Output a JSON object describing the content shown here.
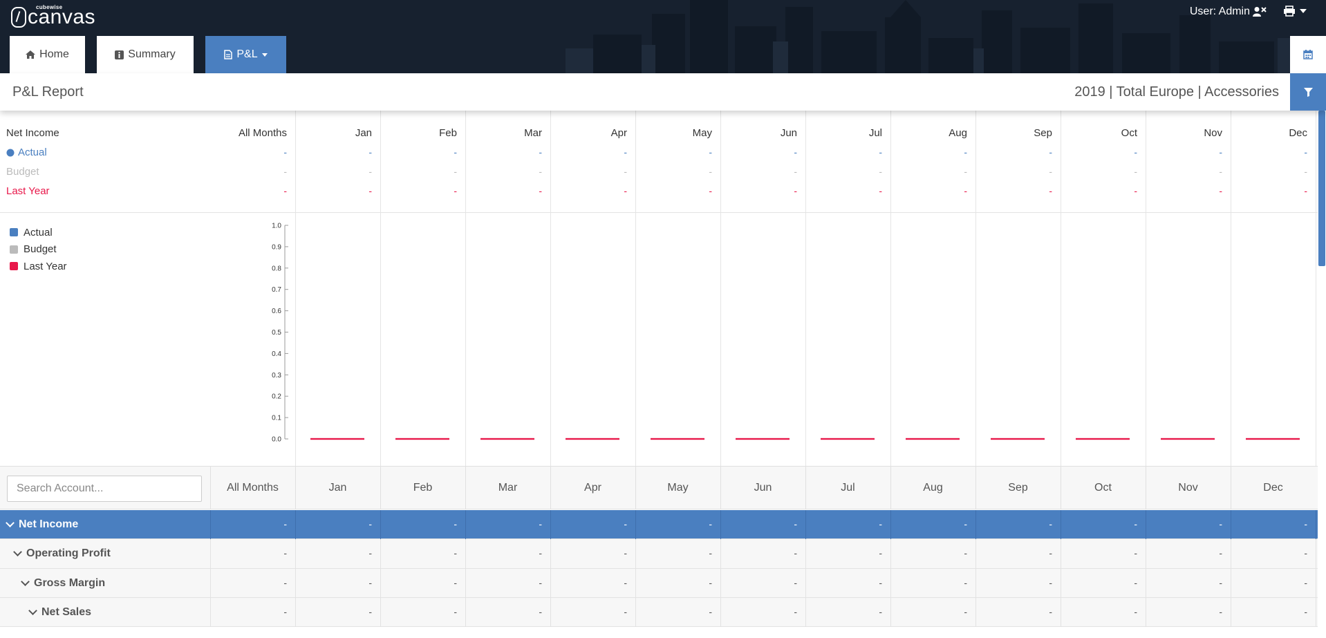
{
  "app": {
    "logo_small": "cubewise",
    "logo": "canvas",
    "user_label": "User: Admin"
  },
  "tabs": [
    {
      "label": "Home",
      "icon": "home-icon"
    },
    {
      "label": "Summary",
      "icon": "info-icon"
    },
    {
      "label": "P&L",
      "icon": "document-icon"
    }
  ],
  "page": {
    "title": "P&L Report",
    "context": "2019 | Total Europe | Accessories"
  },
  "summary": {
    "title": "Net Income",
    "columns": [
      "All Months",
      "Jan",
      "Feb",
      "Mar",
      "Apr",
      "May",
      "Jun",
      "Jul",
      "Aug",
      "Sep",
      "Oct",
      "Nov",
      "Dec"
    ],
    "rows": [
      {
        "label": "Actual",
        "color": "#4a7fc0",
        "values": [
          "-",
          "-",
          "-",
          "-",
          "-",
          "-",
          "-",
          "-",
          "-",
          "-",
          "-",
          "-",
          "-"
        ]
      },
      {
        "label": "Budget",
        "color": "#bbbbbb",
        "values": [
          "-",
          "-",
          "-",
          "-",
          "-",
          "-",
          "-",
          "-",
          "-",
          "-",
          "-",
          "-",
          "-"
        ]
      },
      {
        "label": "Last Year",
        "color": "#e8184a",
        "values": [
          "-",
          "-",
          "-",
          "-",
          "-",
          "-",
          "-",
          "-",
          "-",
          "-",
          "-",
          "-",
          "-"
        ]
      }
    ]
  },
  "chart_data": {
    "type": "bar",
    "categories": [
      "Jan",
      "Feb",
      "Mar",
      "Apr",
      "May",
      "Jun",
      "Jul",
      "Aug",
      "Sep",
      "Oct",
      "Nov",
      "Dec"
    ],
    "series": [
      {
        "name": "Actual",
        "color": "#4a7fc0",
        "values": [
          0,
          0,
          0,
          0,
          0,
          0,
          0,
          0,
          0,
          0,
          0,
          0
        ]
      },
      {
        "name": "Budget",
        "color": "#bbbbbb",
        "values": [
          0,
          0,
          0,
          0,
          0,
          0,
          0,
          0,
          0,
          0,
          0,
          0
        ]
      },
      {
        "name": "Last Year",
        "color": "#e8184a",
        "values": [
          0,
          0,
          0,
          0,
          0,
          0,
          0,
          0,
          0,
          0,
          0,
          0
        ]
      }
    ],
    "yticks": [
      "0.0",
      "0.1",
      "0.2",
      "0.3",
      "0.4",
      "0.5",
      "0.6",
      "0.7",
      "0.8",
      "0.9",
      "1.0"
    ],
    "ylim": [
      0,
      1
    ],
    "legend": "top-left"
  },
  "table": {
    "search_placeholder": "Search Account...",
    "columns": [
      "All Months",
      "Jan",
      "Feb",
      "Mar",
      "Apr",
      "May",
      "Jun",
      "Jul",
      "Aug",
      "Sep",
      "Oct",
      "Nov",
      "Dec"
    ],
    "rows": [
      {
        "label": "Net Income",
        "level": 0,
        "selected": true,
        "values": [
          "-",
          "-",
          "-",
          "-",
          "-",
          "-",
          "-",
          "-",
          "-",
          "-",
          "-",
          "-",
          "-"
        ]
      },
      {
        "label": "Operating Profit",
        "level": 1,
        "selected": false,
        "values": [
          "-",
          "-",
          "-",
          "-",
          "-",
          "-",
          "-",
          "-",
          "-",
          "-",
          "-",
          "-",
          "-"
        ]
      },
      {
        "label": "Gross Margin",
        "level": 2,
        "selected": false,
        "values": [
          "-",
          "-",
          "-",
          "-",
          "-",
          "-",
          "-",
          "-",
          "-",
          "-",
          "-",
          "-",
          "-"
        ]
      },
      {
        "label": "Net Sales",
        "level": 3,
        "selected": false,
        "values": [
          "-",
          "-",
          "-",
          "-",
          "-",
          "-",
          "-",
          "-",
          "-",
          "-",
          "-",
          "-",
          "-"
        ]
      }
    ]
  },
  "colors": {
    "accent": "#4a7fc0",
    "header_bg": "#17212f",
    "last_year": "#e8184a"
  }
}
